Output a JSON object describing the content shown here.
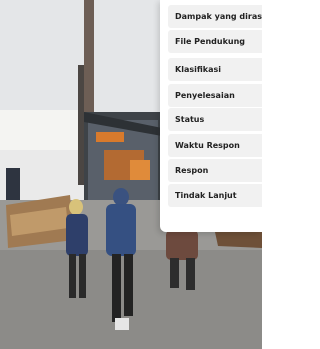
{
  "detail_panel": {
    "fields": [
      {
        "label": "Dampak yang dirasakan"
      },
      {
        "label": "File Pendukung"
      },
      {
        "label": "Klasifikasi"
      },
      {
        "label": "Penyelesaian"
      },
      {
        "label": "Status"
      },
      {
        "label": "Waktu Respon"
      },
      {
        "label": "Respon"
      },
      {
        "label": "Tindak Lanjut"
      }
    ]
  },
  "colors": {
    "panel_background": "#ffffff",
    "row_background": "#f1f1f1",
    "label_text": "#222222"
  }
}
